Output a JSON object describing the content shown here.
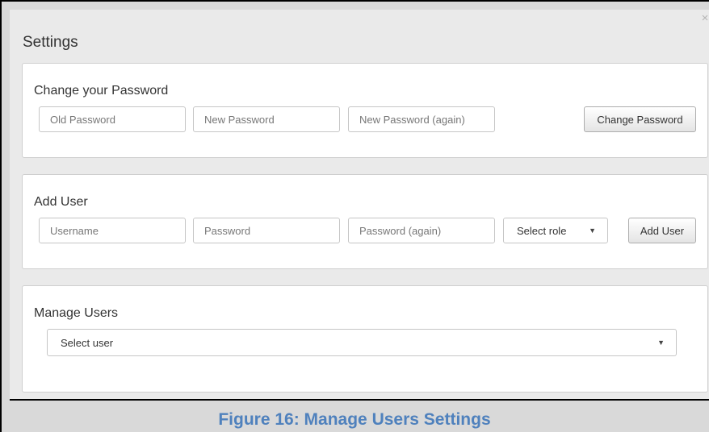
{
  "dialog": {
    "title": "Settings",
    "close_glyph": "×"
  },
  "change_password": {
    "title": "Change your Password",
    "old_placeholder": "Old Password",
    "new_placeholder": "New Password",
    "again_placeholder": "New Password (again)",
    "button_label": "Change Password"
  },
  "add_user": {
    "title": "Add User",
    "username_placeholder": "Username",
    "password_placeholder": "Password",
    "again_placeholder": "Password (again)",
    "role_select": "Select role",
    "button_label": "Add User"
  },
  "manage_users": {
    "title": "Manage Users",
    "user_select": "Select user"
  },
  "icons": {
    "dropdown": "chevron-down-icon",
    "close": "close-icon"
  },
  "caption": "Figure 16: Manage Users Settings"
}
